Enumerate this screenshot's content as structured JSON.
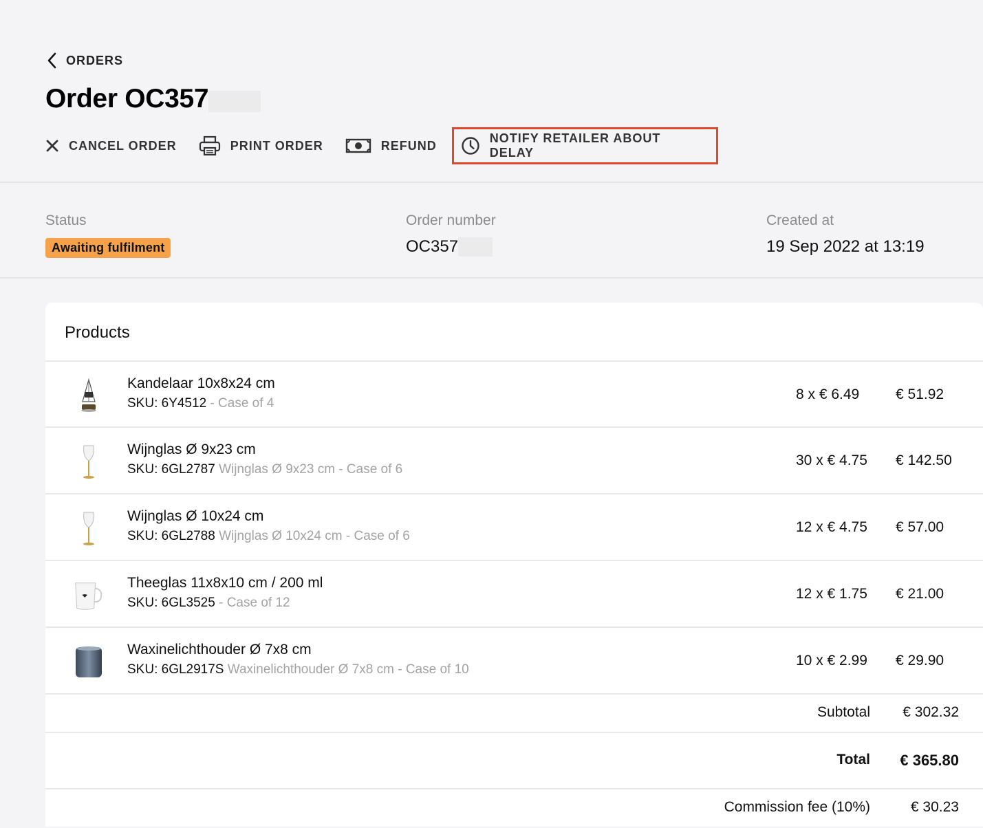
{
  "header": {
    "back_label": "ORDERS",
    "title": "Order OC357"
  },
  "actions": {
    "cancel": "CANCEL ORDER",
    "print": "PRINT ORDER",
    "refund": "REFUND",
    "notify": "NOTIFY RETAILER ABOUT DELAY"
  },
  "info": {
    "status_label": "Status",
    "status_value": "Awaiting fulfilment",
    "order_number_label": "Order number",
    "order_number_value": "OC357",
    "created_label": "Created at",
    "created_value": "19 Sep 2022 at 13:19"
  },
  "products": {
    "title": "Products",
    "items": [
      {
        "name": "Kandelaar 10x8x24 cm",
        "sku": "SKU: 6Y4512",
        "sub": " - Case of 4",
        "qty": "8 x € 6.49",
        "total": "€ 51.92",
        "icon": "candle-holder-icon"
      },
      {
        "name": "Wijnglas Ø 9x23 cm",
        "sku": "SKU: 6GL2787",
        "sub": " Wijnglas Ø 9x23 cm - Case of 6",
        "qty": "30 x € 4.75",
        "total": "€ 142.50",
        "icon": "wine-glass-icon"
      },
      {
        "name": "Wijnglas Ø 10x24 cm",
        "sku": "SKU: 6GL2788",
        "sub": " Wijnglas Ø 10x24 cm - Case of 6",
        "qty": "12 x € 4.75",
        "total": "€ 57.00",
        "icon": "wine-glass-icon"
      },
      {
        "name": "Theeglas 11x8x10 cm / 200 ml",
        "sku": "SKU: 6GL3525",
        "sub": " - Case of 12",
        "qty": "12 x € 1.75",
        "total": "€ 21.00",
        "icon": "tea-glass-icon"
      },
      {
        "name": "Waxinelichthouder Ø 7x8 cm",
        "sku": "SKU: 6GL2917S",
        "sub": " Waxinelichthouder Ø 7x8 cm - Case of 10",
        "qty": "10 x € 2.99",
        "total": "€ 29.90",
        "icon": "tealight-holder-icon"
      }
    ]
  },
  "summary": {
    "subtotal_label": "Subtotal",
    "subtotal_value": "€ 302.32",
    "total_label": "Total",
    "total_value": "€ 365.80",
    "commission_label": "Commission fee (10%)",
    "commission_value": "€ 30.23"
  },
  "colors": {
    "background": "#f4f4f6",
    "status_badge": "#f5a24a",
    "highlight_border": "#e0472f",
    "muted_text": "#a3a3a7"
  }
}
